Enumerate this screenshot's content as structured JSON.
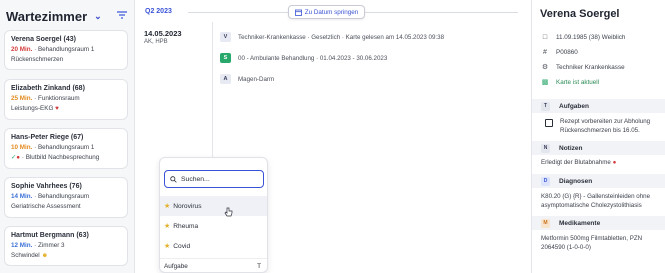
{
  "left": {
    "title": "Wartezimmer",
    "patients": [
      {
        "name": "Verena Soergel (43)",
        "time": "20 Min.",
        "time_color": "red",
        "location": "Behandlungsraum 1",
        "note": "Rückenschmerzen"
      },
      {
        "name": "Elizabeth Zinkand (68)",
        "time": "25 Min.",
        "time_color": "orange",
        "location": "Funktionsraum",
        "note": "Leistungs-EKG"
      },
      {
        "name": "Hans-Peter Riege (67)",
        "time": "10 Min.",
        "time_color": "orange",
        "location": "Behandlungsraum 1",
        "note": "Blutbild Nachbesprechung"
      },
      {
        "name": "Sophie Vahrhees (76)",
        "time": "14 Min.",
        "time_color": "blue",
        "location": "Behandlungsraum",
        "note": "Geriatrische Assessment"
      },
      {
        "name": "Hartmut Bergmann (63)",
        "time": "12 Min.",
        "time_color": "blue",
        "location": "Zimmer 3",
        "note": "Schwindel"
      }
    ]
  },
  "timeline": {
    "quarter": "Q2 2023",
    "jump_label": "Zu Datum springen",
    "date": "14.05.2023",
    "date_sub": "AK, HPB",
    "entries": [
      {
        "badge": "V",
        "text": "Techniker-Krankenkasse · Gesetzlich · Karte gelesen am 14.05.2023 09:38"
      },
      {
        "badge": "S",
        "text": "00 - Ambulante Behandlung · 01.04.2023 - 30.06.2023"
      },
      {
        "badge": "A",
        "text": "Magen-Darm"
      }
    ]
  },
  "dropdown": {
    "search_placeholder": "Suchen...",
    "items": [
      "Norovirus",
      "Rheuma",
      "Covid"
    ],
    "footer": "Aufgabe",
    "footer_key": "T"
  },
  "right": {
    "name": "Verena Soergel",
    "birth": "11.09.1985 (38) Weiblich",
    "id": "P00860",
    "insurance": "Techniker Krankenkasse",
    "card_status": "Karte ist aktuell",
    "sections": {
      "tasks": {
        "label": "Aufgaben",
        "badge": "T",
        "item": "Rezept vorbereiten zur Abholung Rückenschmerzen bis 16.05."
      },
      "notes": {
        "label": "Notizen",
        "badge": "N",
        "text": "Erledigt der Blutabnahme"
      },
      "diagnoses": {
        "label": "Diagnosen",
        "badge": "D",
        "text": "K80.20 (G) {R} - Gallensteinleiden ohne asymptomatische Cholezystolithiasis"
      },
      "meds": {
        "label": "Medikamente",
        "badge": "M",
        "text": "Metformin 500mg Filmtabletten, PZN 2064590 (1-0-0-0)"
      }
    }
  },
  "colors": {
    "accent": "#3a53d6",
    "red": "#d23b3b",
    "orange": "#e28a1e",
    "blue": "#3b6fd6",
    "green": "#29a86b"
  }
}
